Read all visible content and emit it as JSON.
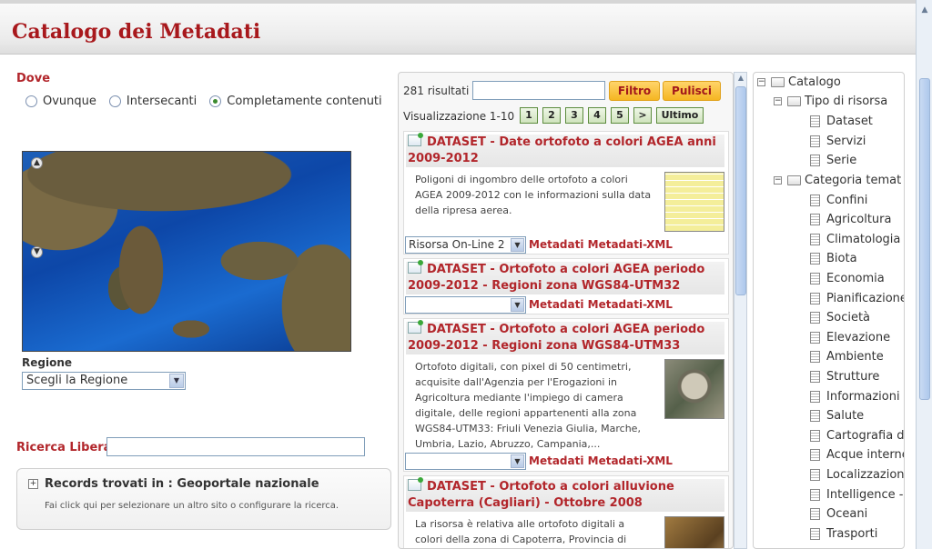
{
  "app": {
    "title": "Catalogo dei Metadati"
  },
  "where": {
    "label": "Dove",
    "options": [
      "Ovunque",
      "Intersecanti",
      "Completamente contenuti"
    ],
    "selected_index": 2
  },
  "region": {
    "label": "Regione",
    "select_value": "Scegli la Regione"
  },
  "free_search": {
    "label": "Ricerca Libera",
    "value": ""
  },
  "records": {
    "title": "Records trovati in : Geoportale nazionale",
    "hint": "Fai click qui per selezionare un altro sito o configurare la ricerca."
  },
  "results": {
    "count": "281 risultati",
    "filter_value": "",
    "filter_button": "Filtro",
    "clear_button": "Pulisci",
    "range": "Visualizzazione 1-10",
    "pages": [
      "1",
      "2",
      "3",
      "4",
      "5",
      ">",
      "Ultimo"
    ],
    "items": [
      {
        "title": "DATASET - Date ortofoto a colori AGEA anni 2009-2012",
        "description": [
          "Poligoni di ingombro delle ortofoto a colori",
          "AGEA 2009-2012 con le informazioni sulla data",
          "della ripresa aerea."
        ],
        "resource_select": "Risorsa On-Line 2",
        "links": "Metadati Metadati-XML"
      },
      {
        "title": "DATASET - Ortofoto a colori AGEA periodo 2009-2012 - Regioni zona WGS84-UTM32",
        "description": [],
        "resource_select": "",
        "links": "Metadati Metadati-XML"
      },
      {
        "title": "DATASET - Ortofoto a colori AGEA periodo 2009-2012 - Regioni zona WGS84-UTM33",
        "description": [
          "Ortofoto digitali, con pixel di 50 centimetri,",
          "acquisite dall'Agenzia per l'Erogazioni in",
          "Agricoltura mediante l'impiego di camera",
          "digitale, delle regioni appartenenti alla zona",
          "WGS84-UTM33: Friuli Venezia Giulia, Marche,",
          "Umbria, Lazio, Abruzzo, Campania,..."
        ],
        "resource_select": "",
        "links": "Metadati Metadati-XML"
      },
      {
        "title": "DATASET - Ortofoto a colori alluvione Capoterra (Cagliari) - Ottobre 2008",
        "description": [
          "La risorsa è relativa alle ortofoto digitali a",
          "colori della zona di Capoterra, Provincia di"
        ],
        "resource_select": "",
        "links": ""
      }
    ]
  },
  "tree": {
    "root": "Catalogo",
    "group1": {
      "label": "Tipo di risorsa",
      "items": [
        "Dataset",
        "Servizi",
        "Serie"
      ]
    },
    "group2": {
      "label": "Categoria temat",
      "items": [
        "Confini",
        "Agricoltura",
        "Climatologia -",
        "Biota",
        "Economia",
        "Pianificazione",
        "Società",
        "Elevazione",
        "Ambiente",
        "Strutture",
        "Informazioni",
        "Salute",
        "Cartografia d",
        "Acque interne",
        "Localizzazion",
        "Intelligence -",
        "Oceani",
        "Trasporti"
      ]
    }
  },
  "colors": {
    "brand": "#a8181c",
    "accent_yellow": "#f5b622"
  }
}
